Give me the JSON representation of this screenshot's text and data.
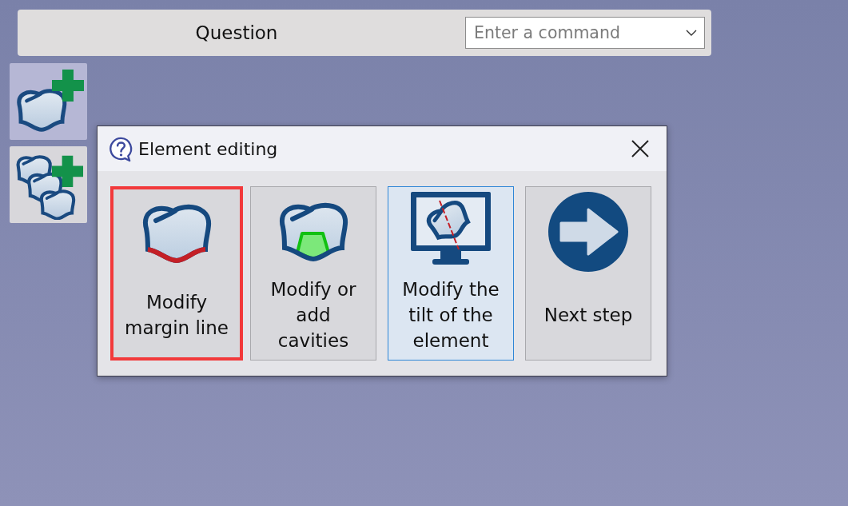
{
  "header": {
    "title": "Question",
    "command_field": {
      "placeholder": "Enter a command"
    }
  },
  "toolbar": [
    {
      "kind": "add-tooth",
      "selected": true
    },
    {
      "kind": "add-teeth",
      "selected": false
    }
  ],
  "dialog": {
    "title": "Element editing",
    "options": [
      {
        "kind": "margin-line",
        "label": "Modify\nmargin line",
        "highlighted": true,
        "selected": false
      },
      {
        "kind": "cavity",
        "label": "Modify or\nadd\ncavities",
        "highlighted": false,
        "selected": false
      },
      {
        "kind": "tilt",
        "label": "Modify the\ntilt of the\nelement",
        "highlighted": false,
        "selected": true
      },
      {
        "kind": "next",
        "label": "Next step",
        "highlighted": false,
        "selected": false
      }
    ]
  }
}
